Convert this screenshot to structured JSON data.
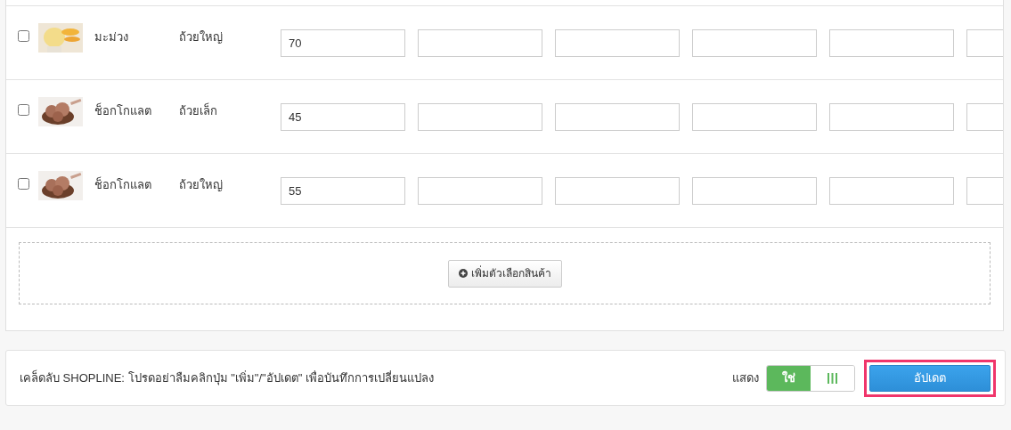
{
  "variants": [
    {
      "checked": false,
      "name": "มะม่วง",
      "size": "ถ้วยใหญ่",
      "price": "70"
    },
    {
      "checked": false,
      "name": "ช็อกโกแลต",
      "size": "ถ้วยเล็ก",
      "price": "45"
    },
    {
      "checked": false,
      "name": "ช็อกโกแลต",
      "size": "ถ้วยใหญ่",
      "price": "55"
    }
  ],
  "add_option_button": "เพิ่มตัวเลือกสินค้า",
  "footer": {
    "tip": "เคล็ดลับ SHOPLINE: โปรดอย่าลืมคลิกปุ่ม \"เพิ่ม\"/\"อัปเดต\" เพื่อบันทึกการเปลี่ยนแปลง",
    "show_label": "แสดง",
    "toggle": {
      "on_label": "ใช่",
      "on": true
    },
    "update_button": {
      "label": "อัปเดต",
      "highlighted": true
    }
  }
}
